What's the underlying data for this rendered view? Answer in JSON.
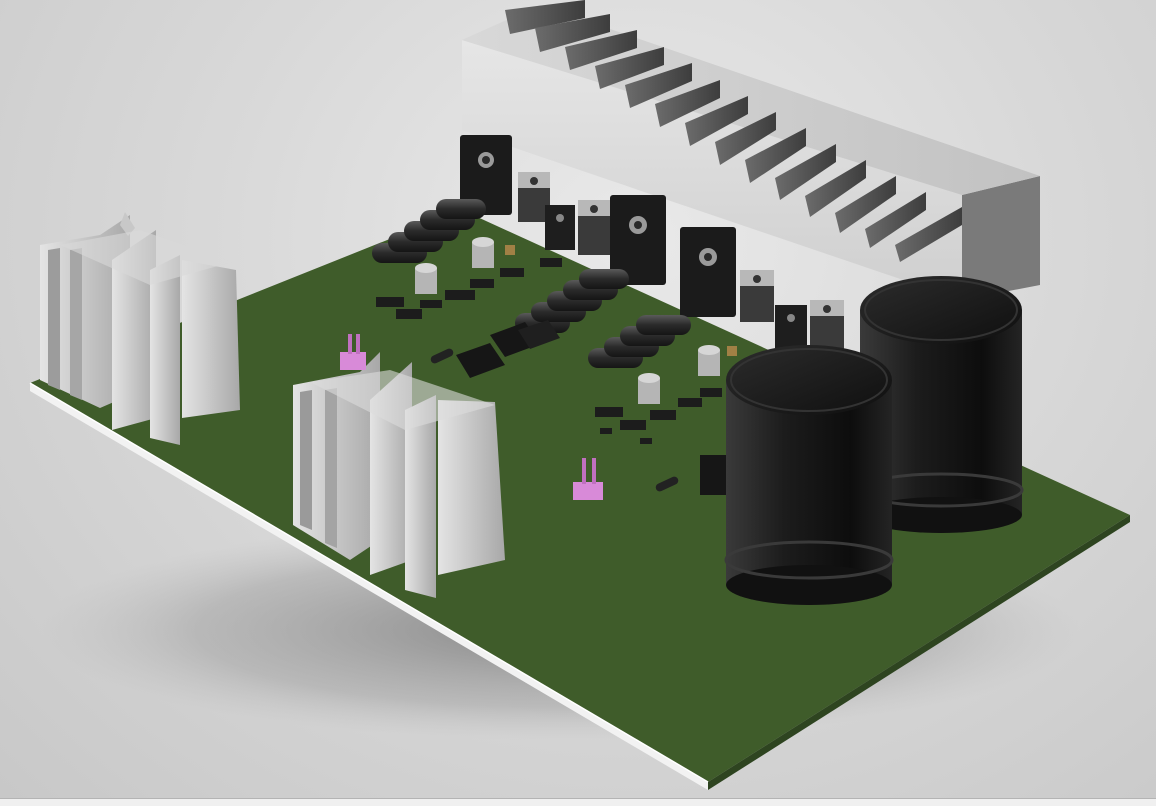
{
  "viewport": {
    "background": "#d9d9d9",
    "board_color": "#3f5c2a",
    "silkscreen_color": "#e8e8e8",
    "heatsink_color": "#c4c4c4",
    "capacitor_color": "#1a1a1a",
    "connector_color": "#d88ad8"
  },
  "statusbar": {
    "background": "#f0f0f0"
  }
}
